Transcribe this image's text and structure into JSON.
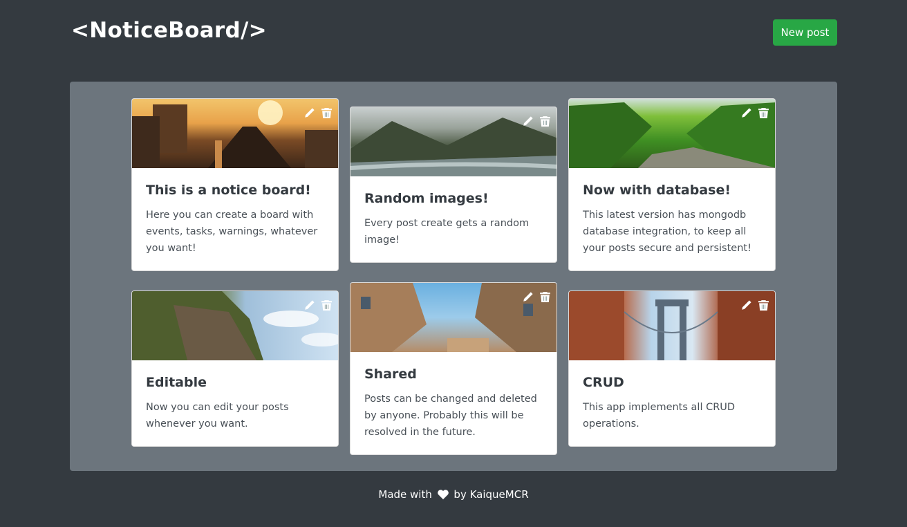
{
  "header": {
    "brand": "<NoticeBoard/>",
    "new_post_label": "New post"
  },
  "cards": [
    {
      "title": "This is a notice board!",
      "text": "Here you can create a board with events, tasks, warnings, whatever you want!",
      "image": "city-sunset-traffic"
    },
    {
      "title": "Random images!",
      "text": "Every post create gets a random image!",
      "image": "misty-river-forest"
    },
    {
      "title": "Now with database!",
      "text": "This latest version has mongodb database integration, to keep all your posts secure and persistent!",
      "image": "green-forest-valley"
    },
    {
      "title": "Editable",
      "text": "Now you can edit your posts whenever you want.",
      "image": "coastal-cliff"
    },
    {
      "title": "Shared",
      "text": "Posts can be changed and deleted by anyone. Probably this will be resolved in the future.",
      "image": "buildings-looking-up"
    },
    {
      "title": "CRUD",
      "text": "This app implements all CRUD operations.",
      "image": "bridge-between-buildings"
    }
  ],
  "icons": {
    "edit": "pencil-icon",
    "delete": "trash-icon",
    "heart": "heart-icon"
  },
  "footer": {
    "prefix": "Made with",
    "suffix": "by KaiqueMCR"
  },
  "colors": {
    "background": "#343a40",
    "board": "#6c757d",
    "accent_button": "#28a745",
    "card": "#ffffff"
  }
}
